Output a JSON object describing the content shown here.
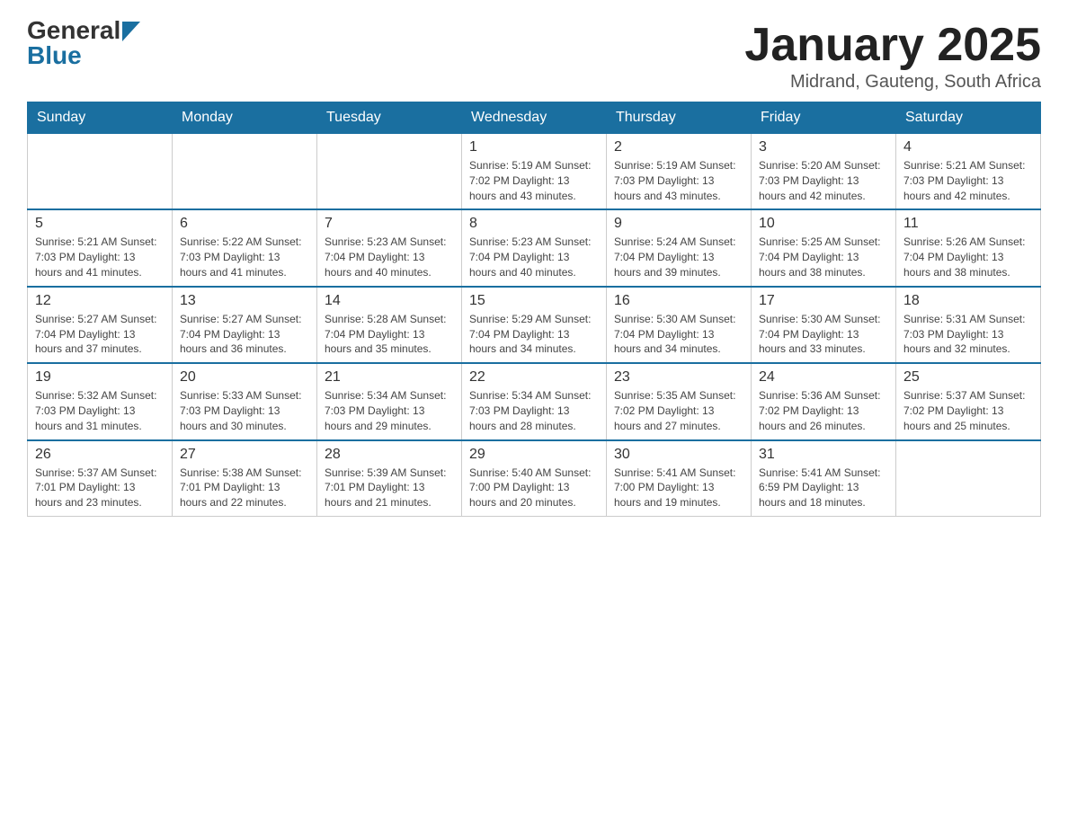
{
  "header": {
    "logo_general": "General",
    "logo_blue": "Blue",
    "month_title": "January 2025",
    "location": "Midrand, Gauteng, South Africa"
  },
  "weekdays": [
    "Sunday",
    "Monday",
    "Tuesday",
    "Wednesday",
    "Thursday",
    "Friday",
    "Saturday"
  ],
  "weeks": [
    [
      {
        "day": "",
        "info": ""
      },
      {
        "day": "",
        "info": ""
      },
      {
        "day": "",
        "info": ""
      },
      {
        "day": "1",
        "info": "Sunrise: 5:19 AM\nSunset: 7:02 PM\nDaylight: 13 hours\nand 43 minutes."
      },
      {
        "day": "2",
        "info": "Sunrise: 5:19 AM\nSunset: 7:03 PM\nDaylight: 13 hours\nand 43 minutes."
      },
      {
        "day": "3",
        "info": "Sunrise: 5:20 AM\nSunset: 7:03 PM\nDaylight: 13 hours\nand 42 minutes."
      },
      {
        "day": "4",
        "info": "Sunrise: 5:21 AM\nSunset: 7:03 PM\nDaylight: 13 hours\nand 42 minutes."
      }
    ],
    [
      {
        "day": "5",
        "info": "Sunrise: 5:21 AM\nSunset: 7:03 PM\nDaylight: 13 hours\nand 41 minutes."
      },
      {
        "day": "6",
        "info": "Sunrise: 5:22 AM\nSunset: 7:03 PM\nDaylight: 13 hours\nand 41 minutes."
      },
      {
        "day": "7",
        "info": "Sunrise: 5:23 AM\nSunset: 7:04 PM\nDaylight: 13 hours\nand 40 minutes."
      },
      {
        "day": "8",
        "info": "Sunrise: 5:23 AM\nSunset: 7:04 PM\nDaylight: 13 hours\nand 40 minutes."
      },
      {
        "day": "9",
        "info": "Sunrise: 5:24 AM\nSunset: 7:04 PM\nDaylight: 13 hours\nand 39 minutes."
      },
      {
        "day": "10",
        "info": "Sunrise: 5:25 AM\nSunset: 7:04 PM\nDaylight: 13 hours\nand 38 minutes."
      },
      {
        "day": "11",
        "info": "Sunrise: 5:26 AM\nSunset: 7:04 PM\nDaylight: 13 hours\nand 38 minutes."
      }
    ],
    [
      {
        "day": "12",
        "info": "Sunrise: 5:27 AM\nSunset: 7:04 PM\nDaylight: 13 hours\nand 37 minutes."
      },
      {
        "day": "13",
        "info": "Sunrise: 5:27 AM\nSunset: 7:04 PM\nDaylight: 13 hours\nand 36 minutes."
      },
      {
        "day": "14",
        "info": "Sunrise: 5:28 AM\nSunset: 7:04 PM\nDaylight: 13 hours\nand 35 minutes."
      },
      {
        "day": "15",
        "info": "Sunrise: 5:29 AM\nSunset: 7:04 PM\nDaylight: 13 hours\nand 34 minutes."
      },
      {
        "day": "16",
        "info": "Sunrise: 5:30 AM\nSunset: 7:04 PM\nDaylight: 13 hours\nand 34 minutes."
      },
      {
        "day": "17",
        "info": "Sunrise: 5:30 AM\nSunset: 7:04 PM\nDaylight: 13 hours\nand 33 minutes."
      },
      {
        "day": "18",
        "info": "Sunrise: 5:31 AM\nSunset: 7:03 PM\nDaylight: 13 hours\nand 32 minutes."
      }
    ],
    [
      {
        "day": "19",
        "info": "Sunrise: 5:32 AM\nSunset: 7:03 PM\nDaylight: 13 hours\nand 31 minutes."
      },
      {
        "day": "20",
        "info": "Sunrise: 5:33 AM\nSunset: 7:03 PM\nDaylight: 13 hours\nand 30 minutes."
      },
      {
        "day": "21",
        "info": "Sunrise: 5:34 AM\nSunset: 7:03 PM\nDaylight: 13 hours\nand 29 minutes."
      },
      {
        "day": "22",
        "info": "Sunrise: 5:34 AM\nSunset: 7:03 PM\nDaylight: 13 hours\nand 28 minutes."
      },
      {
        "day": "23",
        "info": "Sunrise: 5:35 AM\nSunset: 7:02 PM\nDaylight: 13 hours\nand 27 minutes."
      },
      {
        "day": "24",
        "info": "Sunrise: 5:36 AM\nSunset: 7:02 PM\nDaylight: 13 hours\nand 26 minutes."
      },
      {
        "day": "25",
        "info": "Sunrise: 5:37 AM\nSunset: 7:02 PM\nDaylight: 13 hours\nand 25 minutes."
      }
    ],
    [
      {
        "day": "26",
        "info": "Sunrise: 5:37 AM\nSunset: 7:01 PM\nDaylight: 13 hours\nand 23 minutes."
      },
      {
        "day": "27",
        "info": "Sunrise: 5:38 AM\nSunset: 7:01 PM\nDaylight: 13 hours\nand 22 minutes."
      },
      {
        "day": "28",
        "info": "Sunrise: 5:39 AM\nSunset: 7:01 PM\nDaylight: 13 hours\nand 21 minutes."
      },
      {
        "day": "29",
        "info": "Sunrise: 5:40 AM\nSunset: 7:00 PM\nDaylight: 13 hours\nand 20 minutes."
      },
      {
        "day": "30",
        "info": "Sunrise: 5:41 AM\nSunset: 7:00 PM\nDaylight: 13 hours\nand 19 minutes."
      },
      {
        "day": "31",
        "info": "Sunrise: 5:41 AM\nSunset: 6:59 PM\nDaylight: 13 hours\nand 18 minutes."
      },
      {
        "day": "",
        "info": ""
      }
    ]
  ]
}
